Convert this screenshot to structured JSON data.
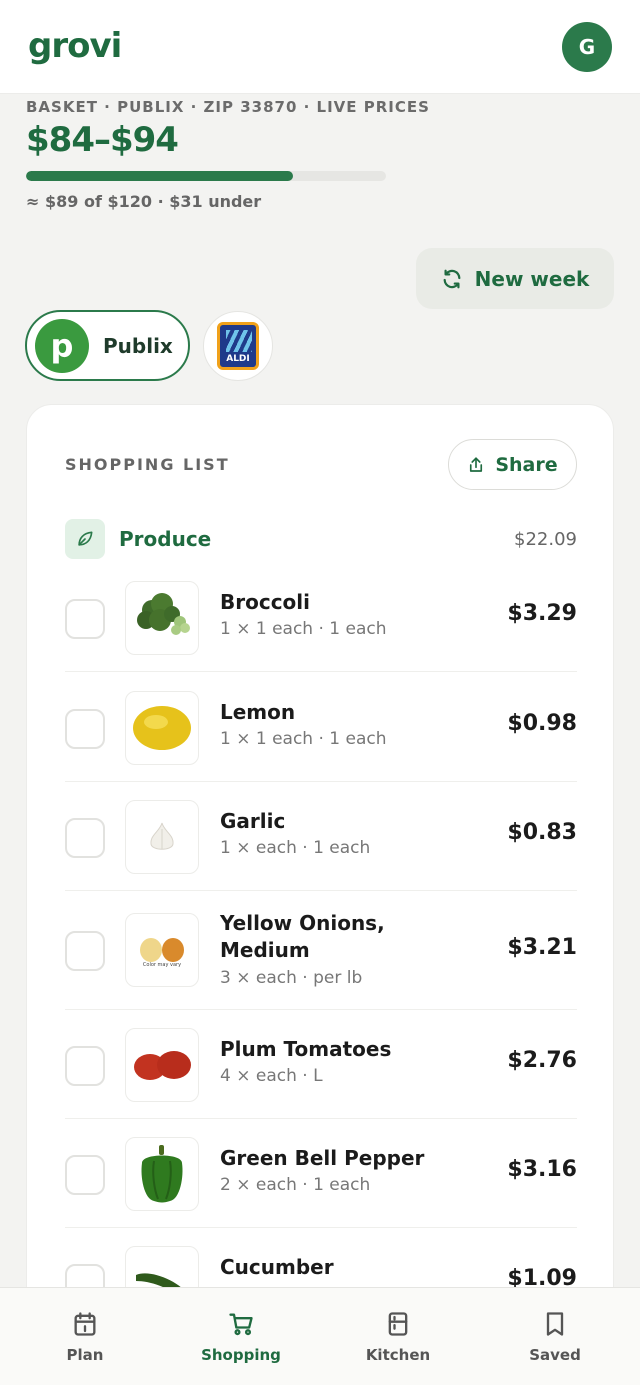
{
  "app": {
    "logo": "grovi",
    "avatar_initial": "G"
  },
  "basket": {
    "meta": "BASKET · PUBLIX · ZIP 33870 · LIVE PRICES",
    "range": "$84–$94",
    "progress_fraction": 0.742,
    "summary": "≈ $89 of $120 · $31 under"
  },
  "actions": {
    "new_week_label": "New week"
  },
  "stores": [
    {
      "name": "Publix",
      "logo_letter": "p",
      "selected": true
    },
    {
      "name": "ALDI",
      "selected": false
    }
  ],
  "shopping_list": {
    "title": "SHOPPING LIST",
    "share_label": "Share",
    "category": {
      "name": "Produce",
      "total": "$22.09",
      "icon": "leaf-icon"
    },
    "items": [
      {
        "name": "Broccoli",
        "detail": "1 × 1 each · 1 each",
        "price": "$3.29"
      },
      {
        "name": "Lemon",
        "detail": "1 × 1 each · 1 each",
        "price": "$0.98"
      },
      {
        "name": "Garlic",
        "detail": "1 × each · 1 each",
        "price": "$0.83"
      },
      {
        "name": "Yellow Onions, Medium",
        "detail": "3 × each · per lb",
        "price": "$3.21",
        "image_caption": "Color may vary"
      },
      {
        "name": "Plum Tomatoes",
        "detail": "4 × each · L",
        "price": "$2.76"
      },
      {
        "name": "Green Bell Pepper",
        "detail": "2 × each · 1 each",
        "price": "$3.16"
      },
      {
        "name": "Cucumber",
        "detail": "",
        "price": "$1.09"
      }
    ]
  },
  "nav": [
    {
      "label": "Plan",
      "icon": "calendar-icon",
      "active": false
    },
    {
      "label": "Shopping",
      "icon": "cart-icon",
      "active": true
    },
    {
      "label": "Kitchen",
      "icon": "fridge-icon",
      "active": false
    },
    {
      "label": "Saved",
      "icon": "bookmark-icon",
      "active": false
    }
  ],
  "colors": {
    "brand": "#1f6b40",
    "accent": "#2b7a4b",
    "background": "#f3f3f1"
  }
}
